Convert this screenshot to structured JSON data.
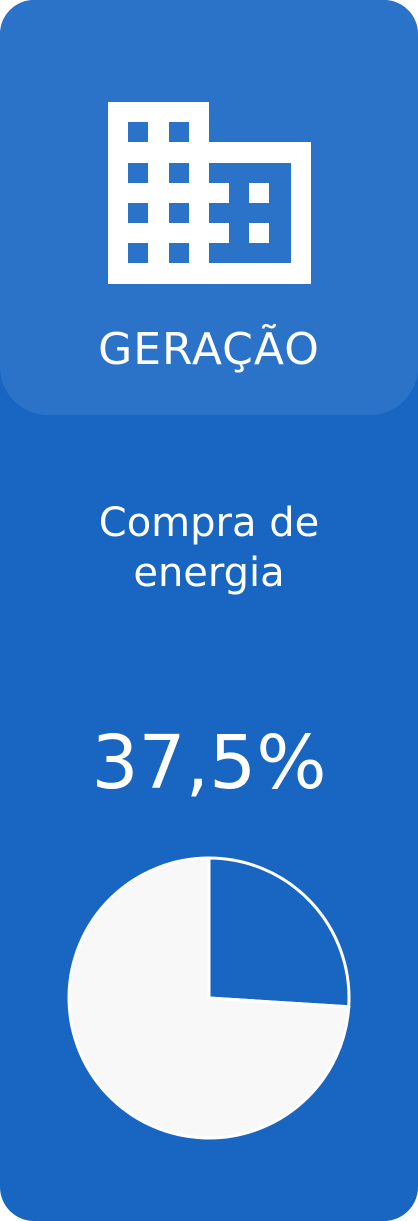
{
  "header": {
    "icon": "building-icon",
    "title": "GERAÇÃO"
  },
  "card": {
    "subtitle_line1": "Compra de",
    "subtitle_line2": "energia",
    "percent_label": "37,5%"
  },
  "chart_data": {
    "type": "pie",
    "title": "",
    "values": [
      26,
      74
    ],
    "colors": [
      "#1866c2",
      "#f8f8f8"
    ]
  },
  "colors": {
    "card_background": "#1866c2",
    "header_background": "#2a73c8",
    "text": "#ffffff",
    "pie_background": "#f8f8f8"
  }
}
